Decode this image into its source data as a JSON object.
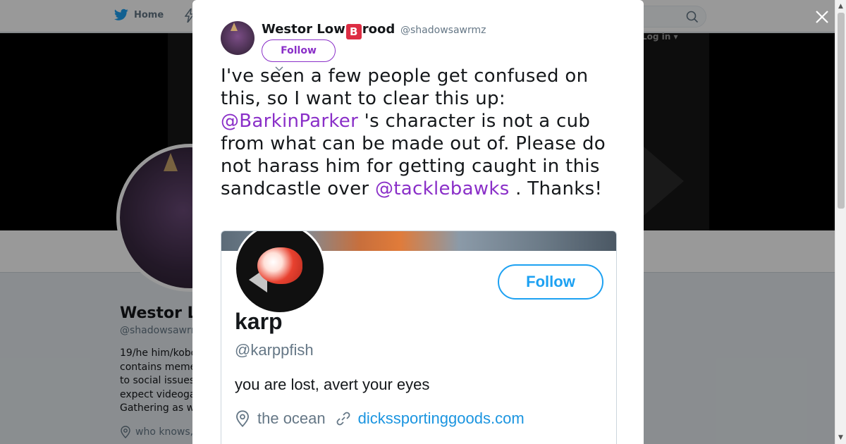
{
  "nav": {
    "home_label": "Home",
    "login_label": "Log in"
  },
  "profile": {
    "name": "Westor L",
    "handle": "@shadowsawrı",
    "bio_lines": [
      "19/he him/kobo",
      "contains meme",
      "to social issues",
      "expect videoga",
      "Gathering as w"
    ],
    "location": "who knows,"
  },
  "tweet": {
    "author_name_pre": "Westor Low",
    "author_name_emoji": "B",
    "author_name_post": "rood",
    "author_handle": "@shadowsawrmz",
    "follow_label": "Follow",
    "text_1": "I've seen a few people get confused on this, so I want to clear this up: ",
    "mention_1": "@BarkinParker",
    "text_2": " 's character is not a cub from what can be made out of. Please do not harass him for getting caught in this sandcastle over ",
    "mention_2": "@tacklebawks",
    "text_3": " . Thanks!"
  },
  "embedded_screenshot": {
    "follow_label": "Follow",
    "name": "karp",
    "handle": "@karppfish",
    "bio": "you are lost, avert your eyes",
    "location": "the ocean",
    "link": "dickssportinggoods.com"
  },
  "colors": {
    "accent_purple": "#8a2fc8",
    "twitter_blue": "#1da1f2",
    "emoji_red": "#dd2e44"
  },
  "icons": {
    "close": "close-icon",
    "search": "search-icon",
    "home": "twitter-bird-icon",
    "location": "map-pin-icon",
    "link": "link-icon",
    "caret": "chevron-down-icon"
  }
}
